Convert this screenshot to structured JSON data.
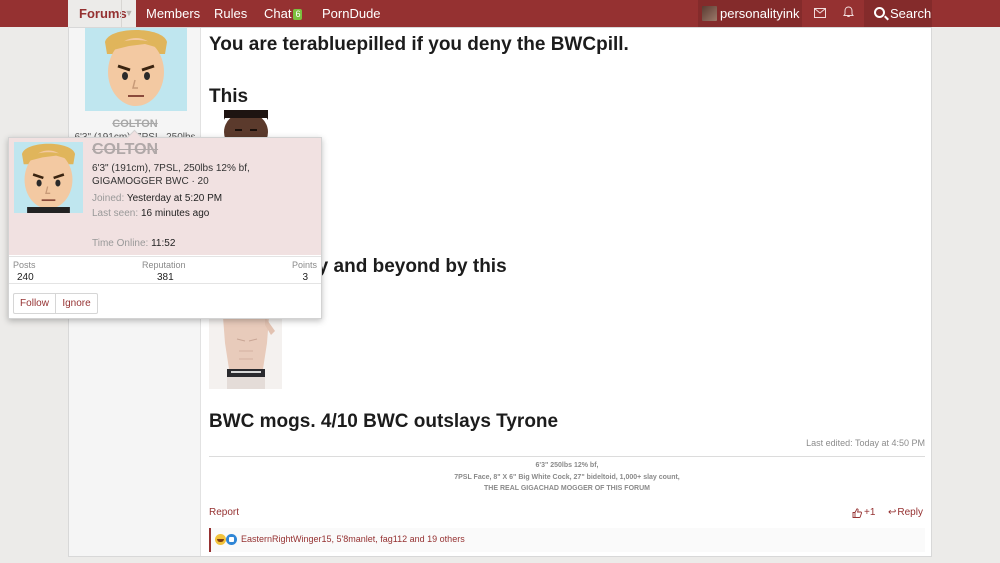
{
  "nav": {
    "forums": "Forums",
    "members": "Members",
    "rules": "Rules",
    "chat": "Chat",
    "chat_badge": "6",
    "porndude": "PornDude",
    "username": "personalityink…",
    "search": "Search"
  },
  "post": {
    "author_name": "COLTON",
    "author_title_partial": "6'3\" (191cm), 7PSL, 250lbs",
    "heading1": "You are terabluepilled if you deny the BWCpill.",
    "heading2": "This",
    "heading3_visible": "d into infinity and beyond by this",
    "heading4": "BWC mogs. 4/10 BWC outslays Tyrone",
    "last_edited": "Last edited: Today at 4:50 PM",
    "signature": [
      "6'3\" 250lbs 12% bf,",
      "7PSL Face, 8\" X 6\" Big White Cock, 27\" bideltoid, 1,000+ slay count,",
      "THE REAL GIGACHAD MOGGER OF THIS FORUM"
    ],
    "report": "Report",
    "like_count": "+1",
    "reply": "Reply",
    "reactions_text": "EasternRightWinger15, 5'8manlet, fag112 and 19 others"
  },
  "tooltip": {
    "name": "COLTON",
    "title": "6'3\" (191cm), 7PSL, 250lbs 12% bf, GIGAMOGGER BWC · 20",
    "joined_label": "Joined:",
    "joined_value": "Yesterday at 5:20 PM",
    "seen_label": "Last seen:",
    "seen_value": "16 minutes ago",
    "online_label": "Time Online:",
    "online_value": "11:52",
    "posts_label": "Posts",
    "posts_value": "240",
    "rep_label": "Reputation",
    "rep_value": "381",
    "points_label": "Points",
    "points_value": "3",
    "follow": "Follow",
    "ignore": "Ignore"
  },
  "colors": {
    "brand": "#953131",
    "tooltip_header": "#f1e1e1",
    "avatar_bg": "#bfe6ef"
  }
}
